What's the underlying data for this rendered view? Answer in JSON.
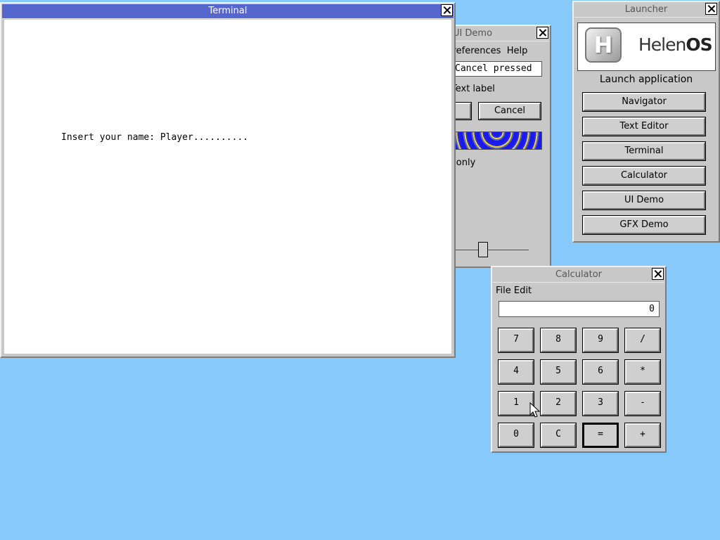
{
  "terminal": {
    "title": "Terminal",
    "line": "Insert your name: Player.........."
  },
  "uidemo": {
    "title": "UI Demo",
    "menu": "Preferences  Help",
    "text_field_value": "Cancel pressed",
    "text_label": "Text label",
    "cancel_label": "Cancel",
    "check_label": "Read only"
  },
  "launcher": {
    "title": "Launcher",
    "logo_h": "H",
    "logo_text_a": "Helen",
    "logo_text_b": "OS",
    "launch_label": "Launch application",
    "buttons": [
      "Navigator",
      "Text Editor",
      "Terminal",
      "Calculator",
      "UI Demo",
      "GFX Demo"
    ]
  },
  "calculator": {
    "title": "Calculator",
    "menu": [
      "File",
      "Edit"
    ],
    "display": "0",
    "keys": [
      "7",
      "8",
      "9",
      "/",
      "4",
      "5",
      "6",
      "*",
      "1",
      "2",
      "3",
      "-",
      "0",
      "C",
      "=",
      "+"
    ]
  }
}
